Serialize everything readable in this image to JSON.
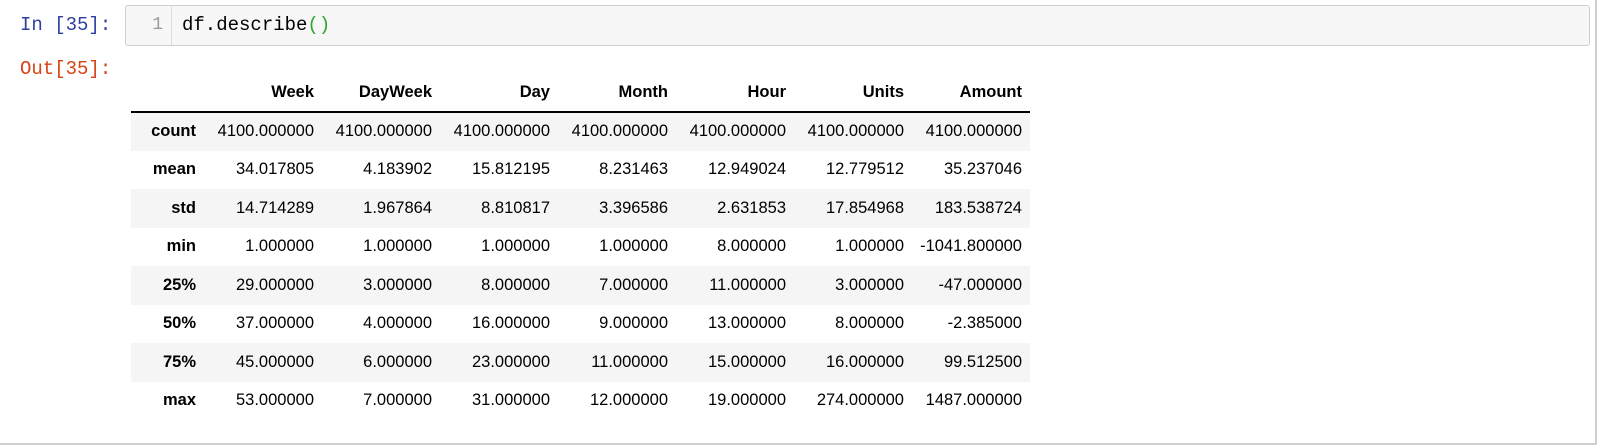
{
  "input": {
    "prompt": "In [35]:",
    "line_number": "1",
    "code_text": "df.describe",
    "code_parens": "()"
  },
  "output": {
    "prompt": "Out[35]:"
  },
  "table": {
    "columns": [
      "Week",
      "DayWeek",
      "Day",
      "Month",
      "Hour",
      "Units",
      "Amount"
    ],
    "rows": [
      {
        "label": "count",
        "values": [
          "4100.000000",
          "4100.000000",
          "4100.000000",
          "4100.000000",
          "4100.000000",
          "4100.000000",
          "4100.000000"
        ]
      },
      {
        "label": "mean",
        "values": [
          "34.017805",
          "4.183902",
          "15.812195",
          "8.231463",
          "12.949024",
          "12.779512",
          "35.237046"
        ]
      },
      {
        "label": "std",
        "values": [
          "14.714289",
          "1.967864",
          "8.810817",
          "3.396586",
          "2.631853",
          "17.854968",
          "183.538724"
        ]
      },
      {
        "label": "min",
        "values": [
          "1.000000",
          "1.000000",
          "1.000000",
          "1.000000",
          "8.000000",
          "1.000000",
          "-1041.800000"
        ]
      },
      {
        "label": "25%",
        "values": [
          "29.000000",
          "3.000000",
          "8.000000",
          "7.000000",
          "11.000000",
          "3.000000",
          "-47.000000"
        ]
      },
      {
        "label": "50%",
        "values": [
          "37.000000",
          "4.000000",
          "16.000000",
          "9.000000",
          "13.000000",
          "8.000000",
          "-2.385000"
        ]
      },
      {
        "label": "75%",
        "values": [
          "45.000000",
          "6.000000",
          "23.000000",
          "11.000000",
          "15.000000",
          "16.000000",
          "99.512500"
        ]
      },
      {
        "label": "max",
        "values": [
          "53.000000",
          "7.000000",
          "31.000000",
          "12.000000",
          "19.000000",
          "274.000000",
          "1487.000000"
        ]
      }
    ]
  },
  "colors": {
    "in_prompt": "#303f9f",
    "out_prompt": "#d84315",
    "paren_match": "#2ea62e",
    "code_background": "#f7f7f7",
    "stripe": "#f5f5f5"
  }
}
